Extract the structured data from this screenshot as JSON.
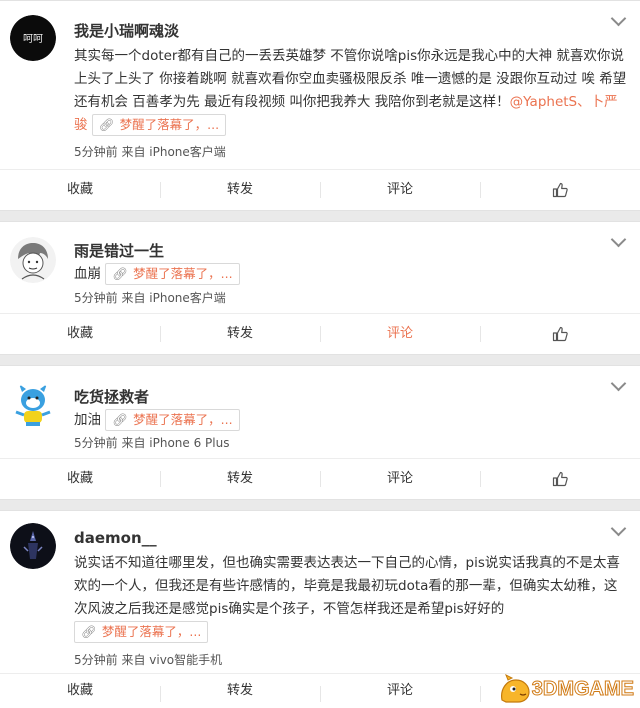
{
  "comments": [
    {
      "user": "我是小瑞啊魂淡",
      "avatar_text": "呵呵",
      "segments": [
        {
          "text": "其实每一个doter都有自己的一丢丢英雄梦 不管你说啥pis你永远是我心中的大神 就喜欢你说 上头了上头了 你接着跳啊 就喜欢看你空血卖骚极限反杀 唯一遗憾的是 没跟你互动过 唉 希望还有机会 百善孝为先 最近有段视频 叫你把我养大 我陪你到老就是这样！"
        },
        {
          "mention": "@YaphetS、卜严骏"
        }
      ],
      "link": "梦醒了落幕了，...",
      "meta": "5分钟前 来自 iPhone客户端"
    },
    {
      "user": "雨是错过一生",
      "segments": [
        {
          "text": "血崩"
        }
      ],
      "link": "梦醒了落幕了，...",
      "meta": "5分钟前 来自 iPhone客户端"
    },
    {
      "user": "吃货拯救者",
      "segments": [
        {
          "text": "加油"
        }
      ],
      "link": "梦醒了落幕了，...",
      "meta": "5分钟前 来自 iPhone 6 Plus"
    },
    {
      "user": "daemon__",
      "segments": [
        {
          "text": "说实话不知道往哪里发，但也确实需要表达表达一下自己的心情，pis说实话我真的不是太喜欢的一个人，但我还是有些许感情的，毕竟是我最初玩dota看的那一辈，但确实太幼稚，这次风波之后我还是感觉pis确实是个孩子，不管怎样我还是希望pis好好的"
        }
      ],
      "link": "梦醒了落幕了，...",
      "meta": "5分钟前 来自 vivo智能手机"
    }
  ],
  "actions": {
    "favorite": "收藏",
    "repost": "转发",
    "comment": "评论"
  },
  "watermark": "3DMGAME",
  "colors": {
    "accent": "#eb7350",
    "background": "#eaeaea"
  }
}
